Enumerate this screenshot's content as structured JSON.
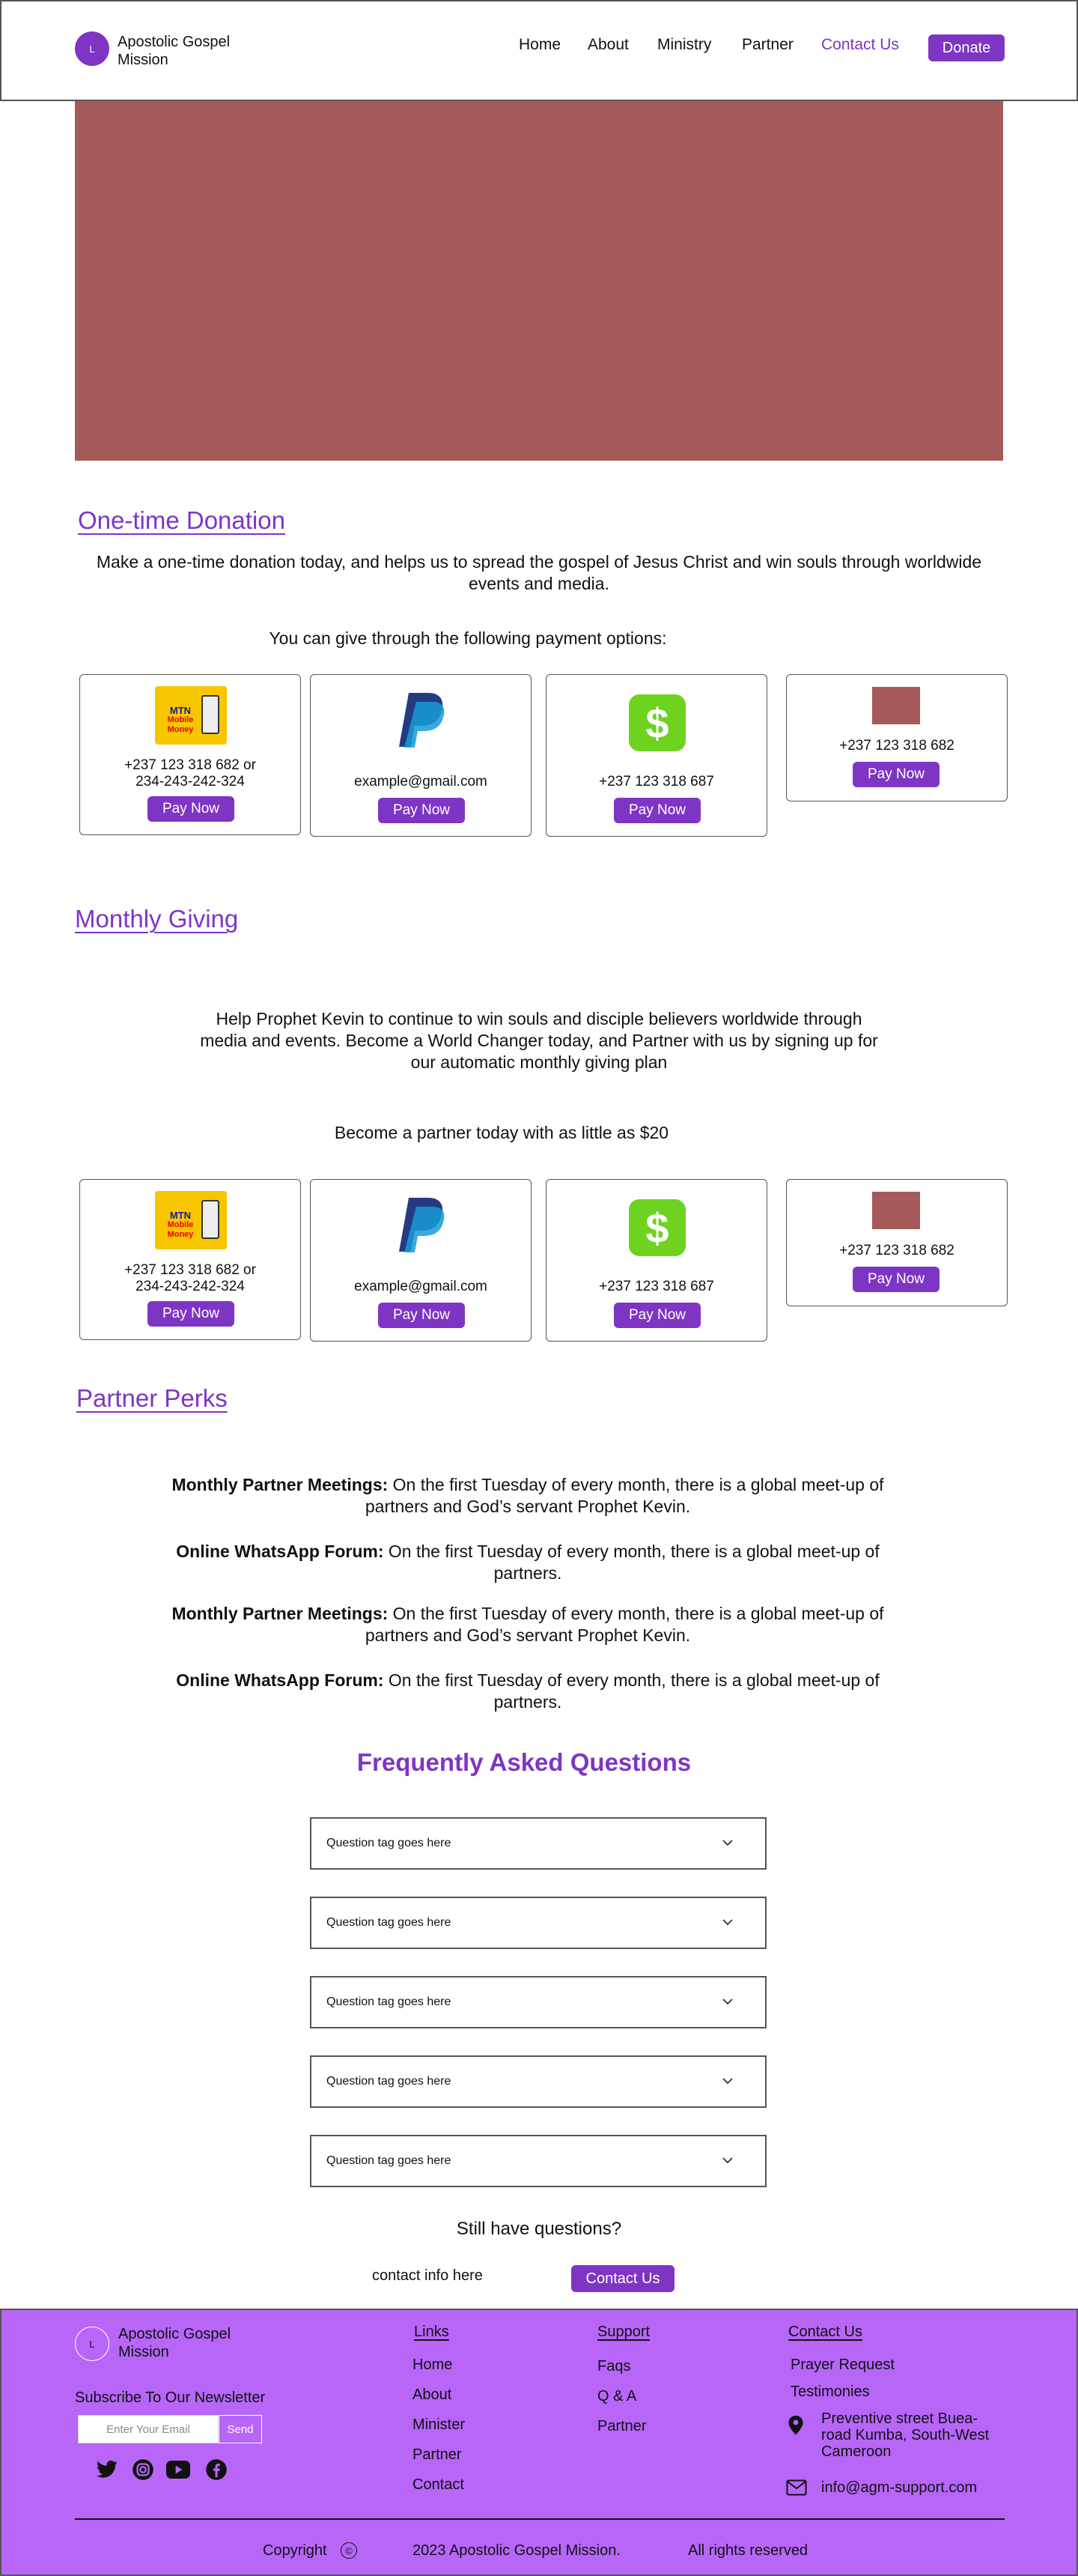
{
  "header": {
    "logo_letter": "L",
    "brand_line1": "Apostolic Gospel",
    "brand_line2": "Mission",
    "nav": [
      "Home",
      "About",
      "Ministry",
      "Partner",
      "Contact Us"
    ],
    "donate_label": "Donate"
  },
  "colors": {
    "accent": "#7e35c4",
    "hero": "#a55a5a",
    "footer": "#b766f8",
    "cashapp": "#6dd320"
  },
  "onetime": {
    "title": "One-time Donation",
    "desc": "Make a one-time donation today, and helps us to spread the gospel of Jesus Christ and win souls through worldwide events and media.",
    "options_label": "You can give through the following payment options:"
  },
  "payment_cards": [
    {
      "icon": "mtn-mobile-money-icon",
      "line1": "+237 123 318 682 or",
      "line2": "234-243-242-324",
      "button": "Pay Now"
    },
    {
      "icon": "paypal-icon",
      "line1": "example@gmail.com",
      "button": "Pay Now"
    },
    {
      "icon": "cashapp-icon",
      "line1": "+237 123 318 687",
      "button": "Pay Now"
    },
    {
      "icon": "placeholder-icon",
      "line1": "+237 123 318 682",
      "button": "Pay Now"
    }
  ],
  "mtn_text": {
    "a": "MTN",
    "b": "Mobile",
    "c": "Money"
  },
  "monthly": {
    "title": "Monthly Giving",
    "desc": "Help Prophet Kevin to continue to win souls and disciple believers worldwide through media and events. Become a World Changer today, and Partner with us by signing up for our automatic monthly giving plan",
    "partner_label": "Become a partner today with as little as $20"
  },
  "perks": {
    "title": "Partner Perks",
    "items": [
      {
        "bold": "Monthly Partner Meetings:",
        "text": " On the first Tuesday of every month, there is a global meet-up of partners and God’s servant Prophet Kevin."
      },
      {
        "bold": "Online WhatsApp Forum:",
        "text": " On the first Tuesday of every month, there is a global meet-up of partners."
      },
      {
        "bold": "Monthly Partner Meetings:",
        "text": " On the first Tuesday of every month, there is a global meet-up of partners and God’s servant Prophet Kevin."
      },
      {
        "bold": "Online WhatsApp Forum:",
        "text": " On the first Tuesday of every month, there is a global meet-up of partners."
      }
    ]
  },
  "faq": {
    "title": "Frequently Asked Questions",
    "questions": [
      "Question tag goes here",
      "Question tag goes here",
      "Question tag goes here",
      "Question tag goes here",
      "Question tag goes here"
    ],
    "still_label": "Still have questions?",
    "contact_info": "contact info here",
    "contact_button": "Contact Us"
  },
  "footer": {
    "logo_letter": "L",
    "brand_line1": "Apostolic Gospel",
    "brand_line2": "Mission",
    "newsletter_label": "Subscribe  To Our Newsletter",
    "email_placeholder": "Enter Your Email",
    "send_label": "Send",
    "social_icons": [
      "twitter-icon",
      "instagram-icon",
      "youtube-icon",
      "facebook-icon"
    ],
    "links_title": "Links",
    "links": [
      "Home",
      "About",
      "Minister",
      "Partner",
      "Contact"
    ],
    "support_title": "Support",
    "support": [
      "Faqs",
      "Q & A",
      "Partner"
    ],
    "contact_title": "Contact Us",
    "contact_links": [
      "Prayer Request",
      "Testimonies"
    ],
    "address_line1": "Preventive street Buea-",
    "address_line2": "road Kumba, South-West",
    "address_line3": "Cameroon",
    "email": "info@agm-support.com",
    "copyright_label": "Copyright",
    "copyright_symbol": "©",
    "copyright_text": "2023 Apostolic Gospel Mission.",
    "rights": "All rights reserved"
  }
}
